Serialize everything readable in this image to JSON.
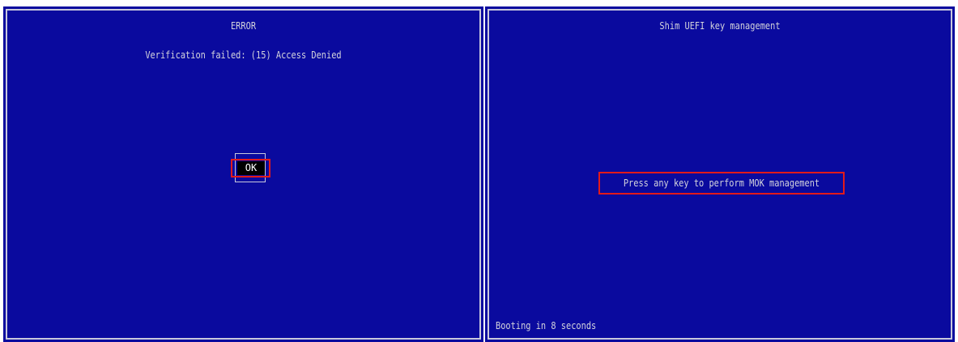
{
  "error_dialog": {
    "title": "ERROR",
    "message": "Verification failed: (15) Access Denied",
    "ok_label": "OK"
  },
  "shim_screen": {
    "title": "Shim UEFI key management",
    "prompt": "Press any key to perform MOK management",
    "countdown": "Booting in 8 seconds"
  },
  "colors": {
    "background": "#0a0a9e",
    "text": "#d4d4dc",
    "highlight_box": "#e21a1a",
    "ok_button_bg": "#000000"
  }
}
